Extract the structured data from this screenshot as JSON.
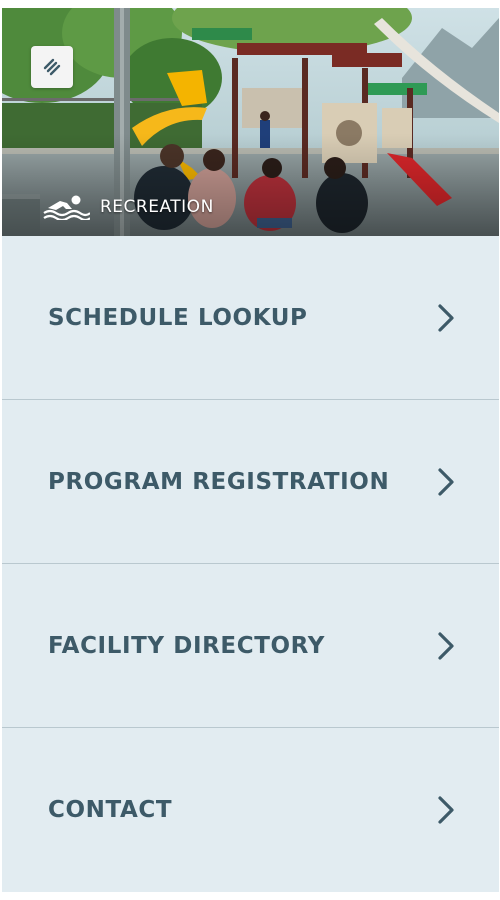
{
  "hero": {
    "section_label": "RECREATION",
    "menu_icon": "layers-menu-icon",
    "section_icon": "swimmer-icon"
  },
  "menu": {
    "items": [
      {
        "label": "SCHEDULE LOOKUP",
        "icon": "chevron-right-icon"
      },
      {
        "label": "PROGRAM REGISTRATION",
        "icon": "chevron-right-icon"
      },
      {
        "label": "FACILITY DIRECTORY",
        "icon": "chevron-right-icon"
      },
      {
        "label": "CONTACT",
        "icon": "chevron-right-icon"
      }
    ]
  },
  "colors": {
    "list_background": "#e2ecf1",
    "label_text": "#3d5a68",
    "divider": "#b9c8cf",
    "hero_label_text": "#ffffff"
  }
}
